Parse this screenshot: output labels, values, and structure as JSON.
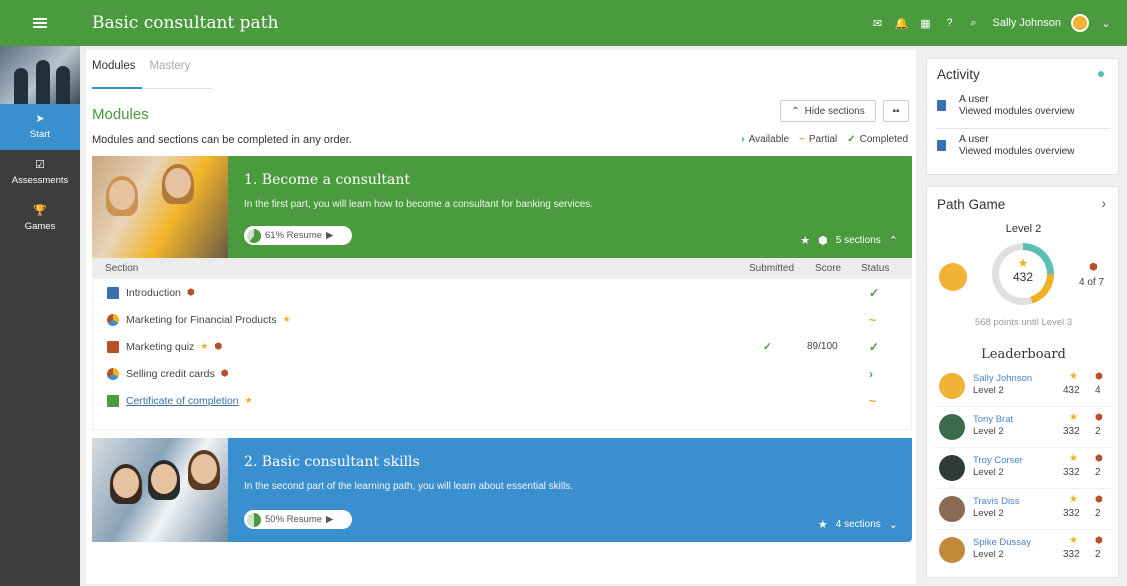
{
  "header": {
    "title": "Basic consultant path",
    "user_name": "Sally Johnson",
    "icons": [
      "menu-icon",
      "mail-icon",
      "bell-icon",
      "calendar-icon",
      "help-icon",
      "search-icon",
      "chevron-down-icon"
    ]
  },
  "sidebar": {
    "items": [
      {
        "label": "Start",
        "icon": "paper-plane-icon",
        "active": true
      },
      {
        "label": "Assessments",
        "icon": "checkbox-icon",
        "active": false
      },
      {
        "label": "Games",
        "icon": "trophy-icon",
        "active": false
      }
    ]
  },
  "main": {
    "tabs": [
      {
        "label": "Modules"
      },
      {
        "label": "Mastery"
      }
    ],
    "heading": "Modules",
    "subtitle": "Modules and sections can be completed in any order.",
    "hide_sections_label": "Hide sections",
    "legend": {
      "available": "Available",
      "partial": "Partial",
      "completed": "Completed"
    },
    "modules": [
      {
        "title": "1. Become a consultant",
        "description": "In the first part, you will learn how to become a consultant for banking services.",
        "resume_label": "61% Resume",
        "progress": 0.61,
        "sections_label": "5 sections",
        "color": "#4a9a3e"
      },
      {
        "title": "2. Basic consultant skills",
        "description": "In the second part of the learning path, you will learn about essential skills.",
        "resume_label": "50% Resume",
        "progress": 0.5,
        "sections_label": "4 sections",
        "color": "#3a8fcf"
      }
    ],
    "section_table": {
      "headers": {
        "section": "Section",
        "submitted": "Submitted",
        "score": "Score",
        "status": "Status"
      },
      "rows": [
        {
          "name": "Introduction",
          "submitted": "",
          "score": "",
          "status": "✓"
        },
        {
          "name": "Marketing for Financial Products",
          "submitted": "",
          "score": "",
          "status": "~"
        },
        {
          "name": "Marketing quiz",
          "submitted": "✓",
          "score": "89/100",
          "status": "✓"
        },
        {
          "name": "Selling credit cards",
          "submitted": "",
          "score": "",
          "status": "›"
        },
        {
          "name": "Certificate of completion",
          "submitted": "",
          "score": "",
          "status": "~"
        }
      ]
    }
  },
  "activity": {
    "title": "Activity",
    "items": [
      {
        "user": "A user",
        "text": "Viewed modules overview"
      },
      {
        "user": "A user",
        "text": "Viewed modules overview"
      }
    ]
  },
  "path_game": {
    "title": "Path Game",
    "level": "Level 2",
    "points": "432",
    "badges": "4 of 7",
    "until_text": "568 points until Level 3",
    "leaderboard_title": "Leaderboard",
    "leaderboard": [
      {
        "name": "Sally Johnson",
        "level": "Level 2",
        "points": "432",
        "count": "4"
      },
      {
        "name": "Tony Brat",
        "level": "Level 2",
        "points": "332",
        "count": "2"
      },
      {
        "name": "Troy Corser",
        "level": "Level 2",
        "points": "332",
        "count": "2"
      },
      {
        "name": "Travis Diss",
        "level": "Level 2",
        "points": "332",
        "count": "2"
      },
      {
        "name": "Spike Dussay",
        "level": "Level 2",
        "points": "332",
        "count": "2"
      }
    ]
  },
  "colors": {
    "brand_green": "#4a9a3e",
    "accent_blue": "#3a8fcf",
    "sidebar_dark": "#3d3d3d",
    "star_gold": "#f0b020",
    "shield_brown": "#b5502a"
  }
}
